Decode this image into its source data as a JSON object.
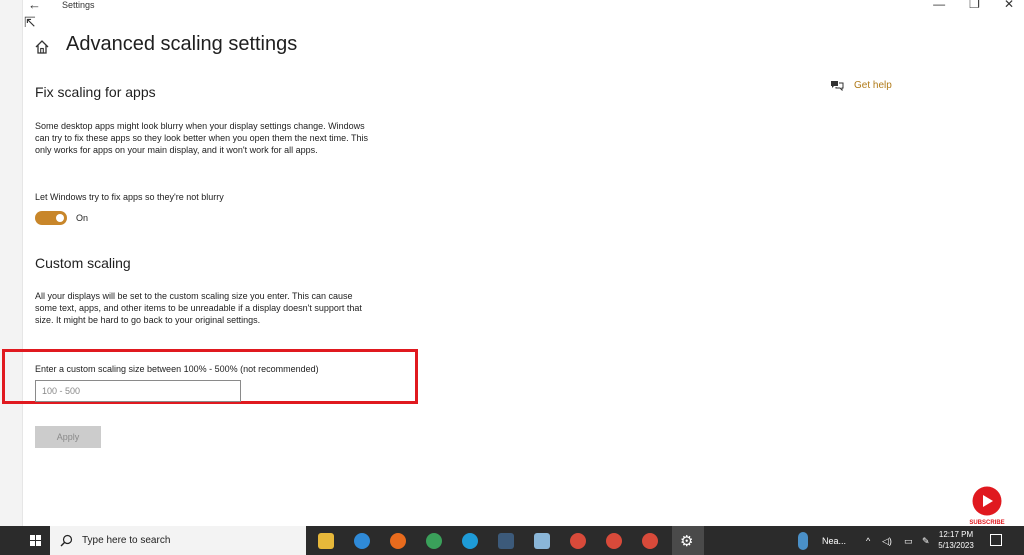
{
  "window": {
    "title": "Settings",
    "back_glyph": "←",
    "controls": {
      "minimize": "—",
      "restore": "❐",
      "close": "✕"
    }
  },
  "page": {
    "title": "Advanced scaling settings"
  },
  "help": {
    "label": "Get help",
    "icon": "chat-help-icon",
    "color": "#b07a18"
  },
  "fix_scaling": {
    "title": "Fix scaling for apps",
    "description": "Some desktop apps might look blurry when your display settings change. Windows can try to fix these apps so they look better when you open them the next time. This only works for apps on your main display, and it won't work for all apps.",
    "toggle_label": "Let Windows try to fix apps so they're not blurry",
    "toggle_state": "On",
    "toggle_on": true,
    "accent": "#c8862a"
  },
  "custom_scaling": {
    "title": "Custom scaling",
    "description": "All your displays will be set to the custom scaling size you enter. This can cause some text, apps, and other items to be unreadable if a display doesn't support that size. It might be hard to go back to your original settings.",
    "input_label": "Enter a custom scaling size between 100% - 500% (not recommended)",
    "input_value": "",
    "input_placeholder": "100 - 500",
    "apply_label": "Apply",
    "highlight_color": "#e0191f"
  },
  "overlay": {
    "subscribe_label": "SUBSCRIBE"
  },
  "taskbar": {
    "search_placeholder": "Type here to search",
    "weather_text": "Nea...",
    "clock_time": "12:17 PM",
    "clock_date": "5/13/2023",
    "pinned": [
      "task-view",
      "file-explorer",
      "edge",
      "firefox",
      "chrome",
      "skype",
      "app",
      "notepad",
      "chrome",
      "chrome",
      "chrome",
      "settings"
    ]
  }
}
